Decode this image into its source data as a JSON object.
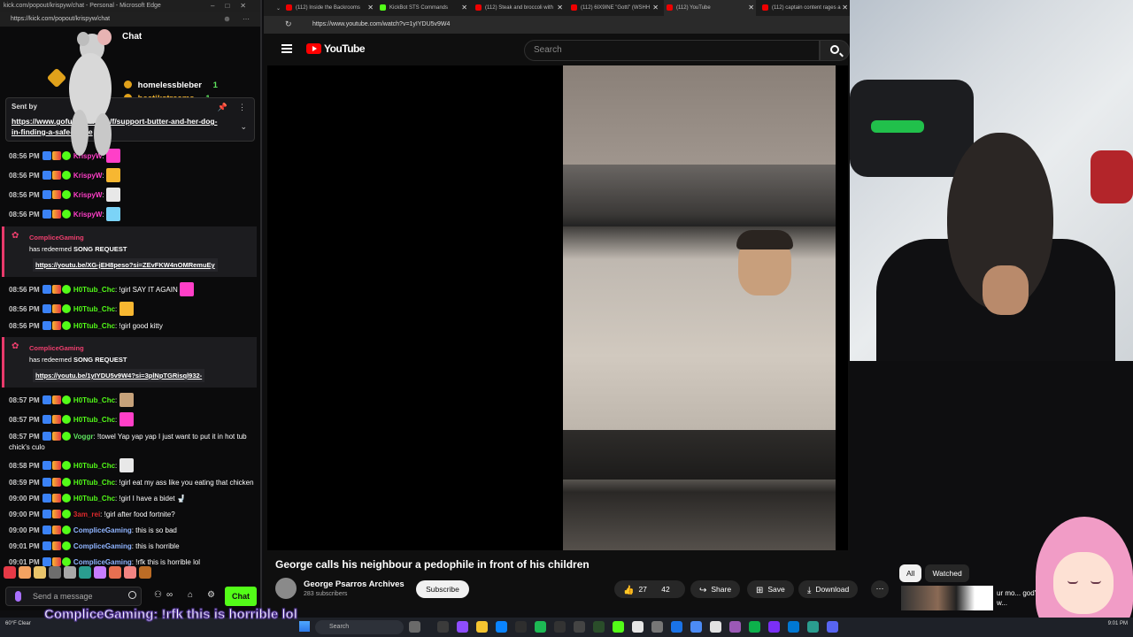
{
  "chat_window": {
    "title_bar": "kick.com/popout/krispyw/chat - Personal - Microsoft Edge",
    "url": "https://kick.com/popout/krispyw/chat",
    "chat_label": "Chat",
    "gifters": [
      {
        "name": "homelessbleber",
        "count": "1",
        "color": "#ffffff"
      },
      {
        "name": "hectikstreams",
        "count": "1",
        "color": "#f7b731"
      }
    ],
    "pinned": {
      "sent_by": "Sent by",
      "link": "https://www.gofundme.com/f/support-butter-and-her-dog-in-finding-a-safe-home"
    },
    "messages": [
      {
        "kind": "msg",
        "time": "08:56 PM",
        "user": "KrispyW",
        "user_color": "#ff3fc8",
        "text": "",
        "emote": true
      },
      {
        "kind": "msg",
        "time": "08:56 PM",
        "user": "KrispyW",
        "user_color": "#ff3fc8",
        "text": "",
        "emote": true
      },
      {
        "kind": "msg",
        "time": "08:56 PM",
        "user": "KrispyW",
        "user_color": "#ff3fc8",
        "text": "",
        "emote": true
      },
      {
        "kind": "msg",
        "time": "08:56 PM",
        "user": "KrispyW",
        "user_color": "#ff3fc8",
        "text": "",
        "emote": true
      },
      {
        "kind": "redeem",
        "user": "ComplicеGaming",
        "action": "has redeemed",
        "reward": "SONG REQUEST",
        "url": "https://youtu.be/XG-jEH8peso?si=ZEvFKW4nOMRemuEy"
      },
      {
        "kind": "msg",
        "time": "08:56 PM",
        "user": "H0Ttub_Chc",
        "user_color": "#53fc18",
        "text": "!girl SAY IT AGAIN",
        "emote": true
      },
      {
        "kind": "msg",
        "time": "08:56 PM",
        "user": "H0Ttub_Chc",
        "user_color": "#53fc18",
        "text": "",
        "emote": true
      },
      {
        "kind": "msg",
        "time": "08:56 PM",
        "user": "H0Ttub_Chc",
        "user_color": "#53fc18",
        "text": "!girl good kitty",
        "emote": false
      },
      {
        "kind": "redeem",
        "user": "ComplicеGaming",
        "action": "has redeemed",
        "reward": "SONG REQUEST",
        "url": "https://youtu.be/1yIYDU5v9W4?si=3plNpTGRisql932-"
      },
      {
        "kind": "msg",
        "time": "08:57 PM",
        "user": "H0Ttub_Chc",
        "user_color": "#53fc18",
        "text": "",
        "emote": true
      },
      {
        "kind": "msg",
        "time": "08:57 PM",
        "user": "H0Ttub_Chc",
        "user_color": "#53fc18",
        "text": "",
        "emote": true
      },
      {
        "kind": "msg",
        "time": "08:57 PM",
        "user": "Voggr",
        "user_color": "#5ee35e",
        "text": "!towel Yap yap yap I just want to put it in hot tub chick's culo",
        "emote": false
      },
      {
        "kind": "msg",
        "time": "08:58 PM",
        "user": "H0Ttub_Chc",
        "user_color": "#53fc18",
        "text": "",
        "emote": true
      },
      {
        "kind": "msg",
        "time": "08:59 PM",
        "user": "H0Ttub_Chc",
        "user_color": "#53fc18",
        "text": "!girl eat my ass like you eating that chicken",
        "emote": false
      },
      {
        "kind": "msg",
        "time": "09:00 PM",
        "user": "H0Ttub_Chc",
        "user_color": "#53fc18",
        "text": "!girl I have a bidet 🚽",
        "emote": false
      },
      {
        "kind": "msg",
        "time": "09:00 PM",
        "user": "3am_rei",
        "user_color": "#e0292c",
        "text": "!girl after food fortnite?",
        "emote": false
      },
      {
        "kind": "msg",
        "time": "09:00 PM",
        "user": "ComplicеGaming",
        "user_color": "#8fb4ff",
        "text": "this is so bad",
        "emote": false
      },
      {
        "kind": "msg",
        "time": "09:01 PM",
        "user": "ComplicеGaming",
        "user_color": "#8fb4ff",
        "text": "this is horrible",
        "emote": false
      },
      {
        "kind": "msg",
        "time": "09:01 PM",
        "user": "ComplicеGaming",
        "user_color": "#8fb4ff",
        "text": "!rfk this is horrible lol",
        "emote": false
      }
    ],
    "input_placeholder": "Send a message",
    "send_label": "Chat"
  },
  "youtube": {
    "tabs": [
      {
        "label": "(112) Inside the Backrooms",
        "active": false
      },
      {
        "label": "KickBot STS Commands",
        "active": false
      },
      {
        "label": "(112) Steak and broccoli with",
        "active": false
      },
      {
        "label": "(112) 6IX9INE \"Gotti\" (WSHH",
        "active": false
      },
      {
        "label": "(112) YouTube",
        "active": true
      },
      {
        "label": "(112) captain content rages a",
        "active": false
      }
    ],
    "url": "https://www.youtube.com/watch?v=1yIYDU5v9W4",
    "logo_text": "YouTube",
    "search_placeholder": "Search",
    "video_title": "George calls his neighbour a pedophile in front of his children",
    "channel_name": "George Psarros Archives",
    "subscribers": "283 subscribers",
    "subscribe_label": "Subscribe",
    "likes": "27",
    "dislikes": "42",
    "share_label": "Share",
    "save_label": "Save",
    "download_label": "Download"
  },
  "sidebar_chips": {
    "all": "All",
    "watched": "Watched"
  },
  "suggestion_title": "ur mo... god's w...",
  "overlay_caption": "ComplicеGaming: !rfk this is horrible lol",
  "taskbar": {
    "weather": "60°F Clear",
    "search_placeholder": "Search",
    "clock": "9:01 PM"
  },
  "colors": {
    "kick_green": "#53fc18",
    "yt_red": "#ff0000",
    "redeem_pink": "#ef3f6e"
  }
}
